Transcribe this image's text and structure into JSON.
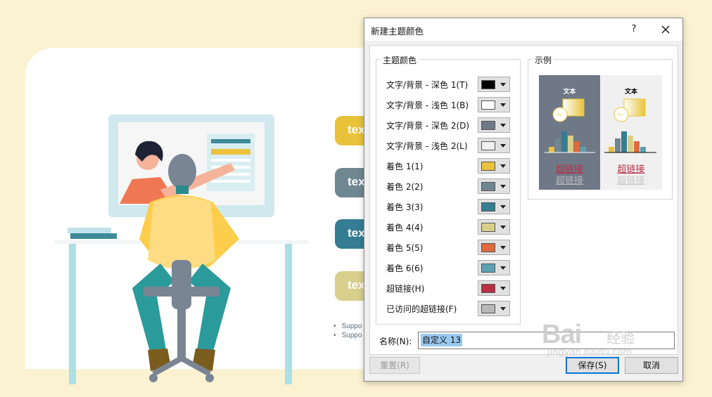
{
  "slide": {
    "pill_texts": [
      "tex",
      "tex",
      "tex",
      "tex"
    ],
    "bullets": [
      "Suppo",
      "Suppo"
    ]
  },
  "colors": {
    "slide_bg": "#fbf2d2",
    "pill1": "#e8c33a",
    "pill2": "#6f8791",
    "pill3": "#357d92",
    "pill4": "#d8cf8d"
  },
  "dialog": {
    "title": "新建主题颜色",
    "help": "?",
    "theme_group": "主题颜色",
    "sample_group": "示例",
    "rows": [
      {
        "label": "文字/背景 - 深色 1(T)",
        "color": "#000000"
      },
      {
        "label": "文字/背景 - 浅色 1(B)",
        "color": "#ffffff"
      },
      {
        "label": "文字/背景 - 深色 2(D)",
        "color": "#6f7887"
      },
      {
        "label": "文字/背景 - 浅色 2(L)",
        "color": "#f0f0f0"
      },
      {
        "label": "着色 1(1)",
        "color": "#e8c33a"
      },
      {
        "label": "着色 2(2)",
        "color": "#6f8791"
      },
      {
        "label": "着色 3(3)",
        "color": "#357d92"
      },
      {
        "label": "着色 4(4)",
        "color": "#d8cf8d"
      },
      {
        "label": "着色 5(5)",
        "color": "#e06a3e"
      },
      {
        "label": "着色 6(6)",
        "color": "#5e9fb1"
      },
      {
        "label": "超链接(H)",
        "color": "#b83046"
      },
      {
        "label": "已访问的超链接(F)",
        "color": "#b8b8b8"
      }
    ],
    "sample": {
      "text": "文本",
      "hyperlink": "超链接",
      "visited": "超链接"
    },
    "name_label": "名称(N):",
    "name_value": "自定义 13",
    "reset": "重置(R)",
    "save": "保存(S)",
    "cancel": "取消"
  },
  "watermark": {
    "main": "Bai",
    "mid": "经验",
    "sub": "jingyan.baidu.com"
  }
}
